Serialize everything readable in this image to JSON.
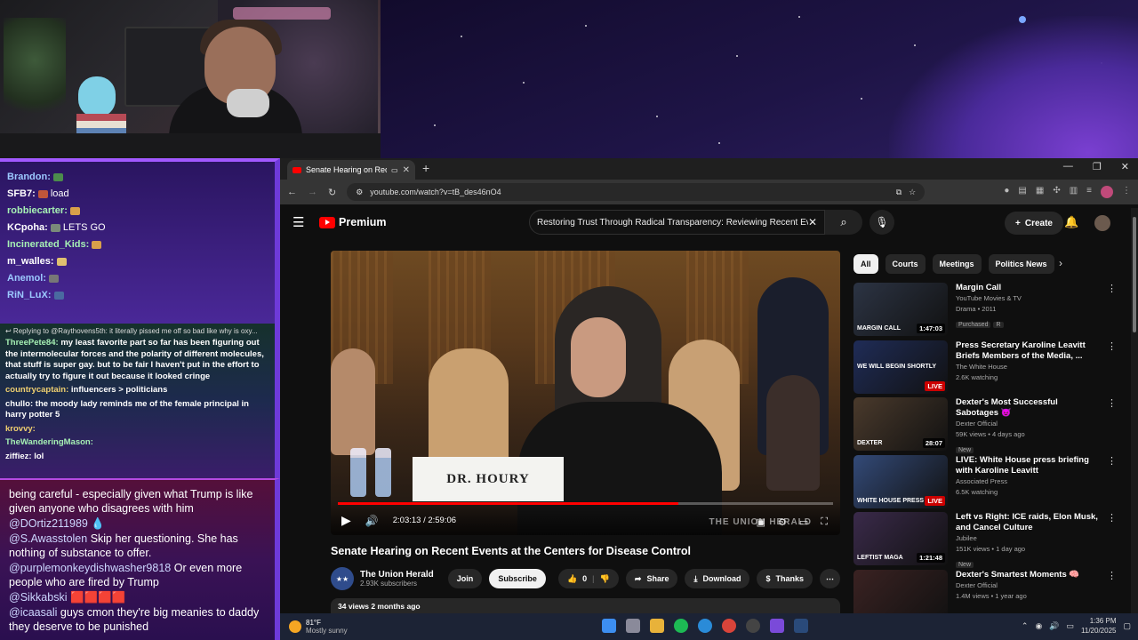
{
  "chat_top": [
    {
      "user": "Brandon:",
      "color": "#9cc9ff",
      "text": "",
      "emote": "#4c8c4c"
    },
    {
      "user": "SFB7:",
      "color": "#ffffff",
      "text": "load",
      "emote": "#c0563a"
    },
    {
      "user": "robbiecarter:",
      "color": "#a6f0b4",
      "text": "",
      "emote": "#d9a04a"
    },
    {
      "user": "KCpoha:",
      "color": "#ffffff",
      "text": "LETS GO",
      "emote": "#7a8a7a"
    },
    {
      "user": "Incinerated_Kids:",
      "color": "#a6f0b4",
      "text": "",
      "emote": "#d9a04a"
    },
    {
      "user": "m_walles:",
      "color": "#ffffff",
      "text": "",
      "emote": "#e0c070"
    },
    {
      "user": "Anemol:",
      "color": "#9cc9ff",
      "text": "",
      "emote": "#777777"
    },
    {
      "user": "RiN_LuX:",
      "color": "#9cc9ff",
      "text": "",
      "emote": "#4a6aa0"
    }
  ],
  "chat_mid": {
    "reply": "↩ Replying to @Raythovens5th: it literally pissed me off so bad like why is oxy...",
    "messages": [
      {
        "user": "ThreePete84:",
        "color": "#a6f0b4",
        "text": "my least favorite part so far has been figuring out the intermolecular forces and the polarity of different molecules, that stuff is super gay. but to be fair I haven't put in the effort to actually try to figure it out because it looked cringe"
      },
      {
        "user": "countrycaptain:",
        "color": "#f0d070",
        "text": "influencers > politicians"
      },
      {
        "user": "chullo:",
        "color": "#ffffff",
        "text": "the moody lady reminds me of the female principal in harry potter 5"
      },
      {
        "user": "krovvy:",
        "color": "#f0d070",
        "text": ""
      },
      {
        "user": "TheWanderingMason:",
        "color": "#a6f0b4",
        "text": ""
      },
      {
        "user": "ziffiez:",
        "color": "#ffffff",
        "text": "lol"
      }
    ]
  },
  "chat_bottom": [
    {
      "user": "",
      "text": "being careful - especially given what Trump is like given anyone who disagrees with him"
    },
    {
      "user": "@DOrtiz211989",
      "text": "💧"
    },
    {
      "user": "@S.Awasstolen",
      "text": "Skip her questioning. She has nothing of substance to offer."
    },
    {
      "user": "@purplemonkeydishwasher9818",
      "text": "Or even more people who are fired by Trump"
    },
    {
      "user": "@Sikkabski",
      "text": "🟥🟥🟥🟥"
    },
    {
      "user": "@icaasali",
      "text": "guys cmon they're big meanies to daddy they deserve to be punished"
    }
  ],
  "browser": {
    "tab_title": "Senate Hearing on Recent E",
    "new_tab": "+",
    "url": "youtube.com/watch?v=tB_des46nO4",
    "window_controls": [
      "—",
      "❐",
      "✕"
    ]
  },
  "youtube": {
    "logo": "Premium",
    "search": "Restoring Trust Through Radical Transparency: Reviewing Recent Eve",
    "create": "Create",
    "video": {
      "nameplate": "DR. HOURY",
      "time": "2:03:13 / 2:59:06",
      "progress": 0.687,
      "watermark": "THE UNION HERALD",
      "title": "Senate Hearing on Recent Events at the Centers for Disease Control"
    },
    "channel": {
      "name": "The Union Herald",
      "subs": "2.93K subscribers",
      "join": "Join",
      "subscribe": "Subscribe",
      "likes": "0",
      "share": "Share",
      "download": "Download",
      "thanks": "Thanks",
      "more": "⋯"
    },
    "desc": "34 views  2 months ago",
    "chips": [
      "All",
      "Courts",
      "Meetings",
      "Politics News"
    ],
    "recs": [
      {
        "title": "Margin Call",
        "channel": "YouTube Movies & TV",
        "meta": "Drama • 2011",
        "badges": [
          "Purchased",
          "R"
        ],
        "duration": "1:47:03",
        "live": false,
        "thumb": "#2c3444",
        "label": "MARGIN CALL"
      },
      {
        "title": "Press Secretary Karoline Leavitt Briefs Members of the Media, ...",
        "channel": "The White House",
        "meta": "2.6K watching",
        "badges": [],
        "duration": "LIVE",
        "live": true,
        "thumb": "#1f2c57",
        "label": "WE WILL BEGIN SHORTLY"
      },
      {
        "title": "Dexter's Most Successful Sabotages 😈",
        "channel": "Dexter Official",
        "meta": "59K views • 4 days ago",
        "badges": [
          "New"
        ],
        "duration": "28:07",
        "live": false,
        "thumb": "#4a3a2c",
        "label": "DEXTER"
      },
      {
        "title": "LIVE: White House press briefing with Karoline Leavitt",
        "channel": "Associated Press",
        "meta": "6.5K watching",
        "badges": [],
        "duration": "LIVE",
        "live": true,
        "thumb": "#334a78",
        "label": "WHITE HOUSE PRESS"
      },
      {
        "title": "Left vs Right: ICE raids, Elon Musk, and Cancel Culture",
        "channel": "Jubilee",
        "meta": "151K views • 1 day ago",
        "badges": [
          "New"
        ],
        "duration": "1:21:48",
        "live": false,
        "thumb": "#3a2a4a",
        "label": "LEFTIST  MAGA"
      },
      {
        "title": "Dexter's Smartest Moments 🧠",
        "channel": "Dexter Official",
        "meta": "1.4M views • 1 year ago",
        "badges": [],
        "duration": "",
        "live": false,
        "thumb": "#3a2222",
        "label": ""
      }
    ]
  },
  "taskbar": {
    "temp": "81°F",
    "weather": "Mostly sunny",
    "time": "1:36 PM",
    "date": "11/20/2025"
  }
}
